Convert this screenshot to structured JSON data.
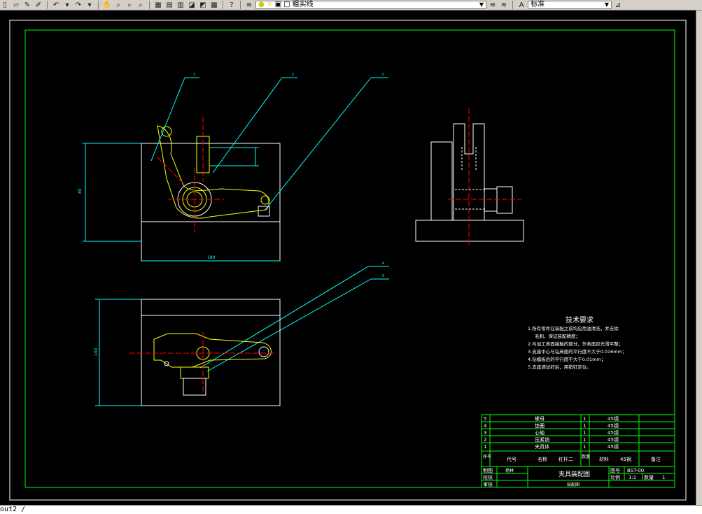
{
  "toolbar": {
    "layer_name": "粗实线",
    "style_name": "标准",
    "icons": [
      "new-icon",
      "open-icon",
      "pen-icon",
      "pencil-icon",
      "undo-icon",
      "redo-icon",
      "pan-icon",
      "zoom-realtime-icon",
      "zoom-window-icon",
      "zoom-previous-icon",
      "properties-icon",
      "design-center-icon",
      "tool-palette-icon",
      "sheet-set-icon",
      "markup-icon",
      "calculator-icon",
      "help-icon",
      "layer-manager-icon",
      "bulb-icon",
      "sun-icon",
      "lock-icon",
      "color-square-icon"
    ]
  },
  "statusbar": {
    "text": "out2 /"
  },
  "drawing": {
    "leaders": [
      "1",
      "2",
      "3",
      "4",
      "5"
    ],
    "dims": {
      "front_height": "80",
      "front_width": "180",
      "top_height": "100"
    },
    "tech_req": {
      "title": "技术要求",
      "lines": [
        "1.所有零件在装配之前均应用油清洗，并去除",
        "毛刺，保证装配精度；",
        "2.与加工表面接触的部分，外表面应光滑平整；",
        "3.支座中心与钻床面的平行度不大于0.016mm；",
        "4.钻模板后的平行度不大于0.01mm；",
        "5.支座调试好后，用销钉定位。"
      ]
    },
    "bom": {
      "rows": [
        {
          "no": "5",
          "name": "螺母",
          "qty": "1",
          "material": "45钢"
        },
        {
          "no": "4",
          "name": "垫圈",
          "qty": "1",
          "material": "45钢"
        },
        {
          "no": "3",
          "name": "心轴",
          "qty": "1",
          "material": "45钢"
        },
        {
          "no": "2",
          "name": "压紧销",
          "qty": "1",
          "material": "45钢"
        },
        {
          "no": "1",
          "name": "夹具体",
          "qty": "1",
          "material": "45钢"
        }
      ],
      "header": {
        "no": "序号",
        "code": "代号",
        "name": "名称",
        "name2": "杠杆二",
        "qty": "数量",
        "material": "材料",
        "material_val": "45钢",
        "remark": "备注"
      }
    },
    "title_block": {
      "title": "夹具装配图",
      "drawing_no_label": "图号",
      "drawing_no": "BST-00",
      "scale_label": "比例",
      "scale": "1:1",
      "qty_label": "数量",
      "qty": "1",
      "draw_label": "制图",
      "draw_name": "杨林",
      "check_label": "校核",
      "audit_label": "审核",
      "sheet_label": "装配图"
    }
  },
  "colors": {
    "frame": "#00ff00",
    "dim": "#00ffff",
    "part": "#ffffff",
    "center": "#ff0000",
    "highlight": "#ffff00",
    "hidden": "#ff00ff"
  }
}
